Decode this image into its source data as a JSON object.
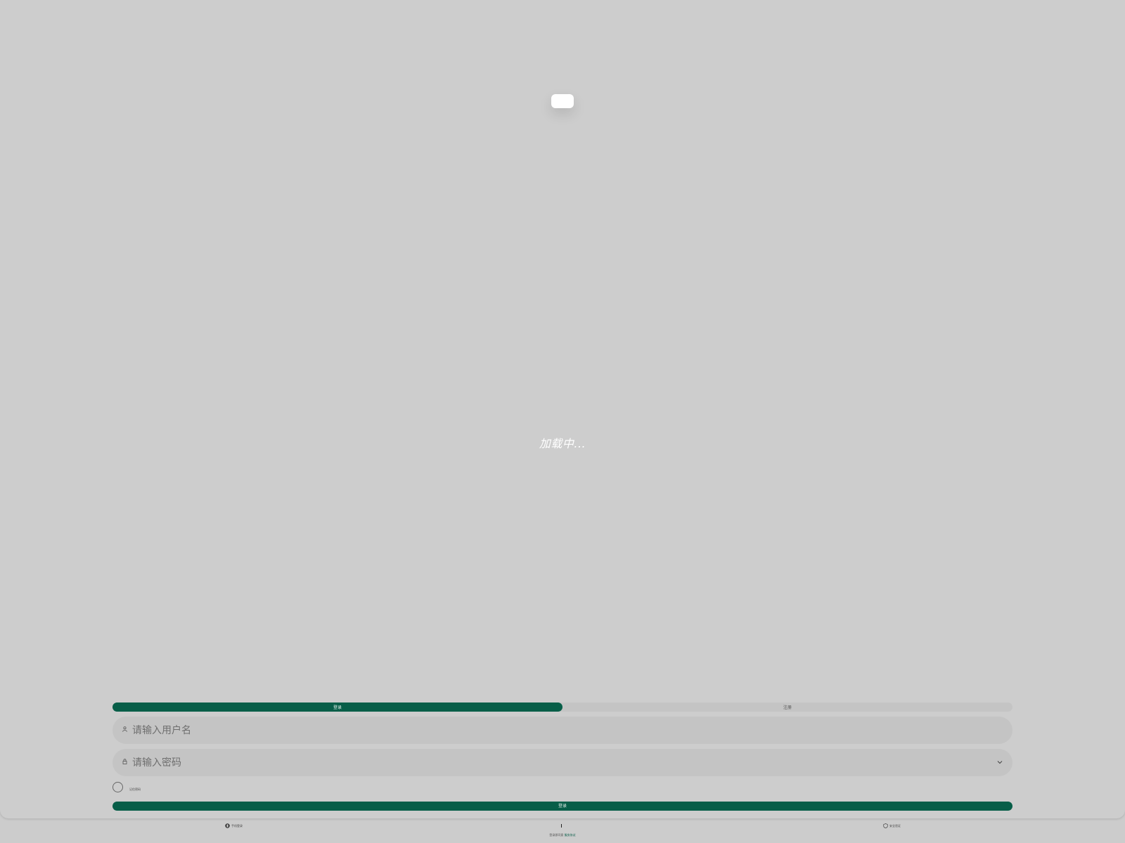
{
  "loading": {
    "text": "加载中..."
  },
  "tabs": [
    {
      "label": "登录",
      "active": true
    },
    {
      "label": "注册",
      "active": false
    }
  ],
  "form": {
    "username": {
      "placeholder": "请输入用户名",
      "value": ""
    },
    "password": {
      "placeholder": "请输入密码",
      "value": ""
    },
    "remember_label": "记住密码",
    "submit_label": "登录"
  },
  "footer": {
    "left_label": "手机登录",
    "right_label": "安全验证",
    "agreement_prefix": "登录即同意",
    "agreement_link": "服务协议"
  },
  "colors": {
    "primary": "#075e48",
    "background": "#cccccc",
    "field": "#c4c4c4"
  },
  "icons": {
    "username": "user-icon",
    "password": "lock-icon",
    "toggle": "chevron-down-icon",
    "footer_left": "phone-icon",
    "footer_right": "shield-icon"
  }
}
